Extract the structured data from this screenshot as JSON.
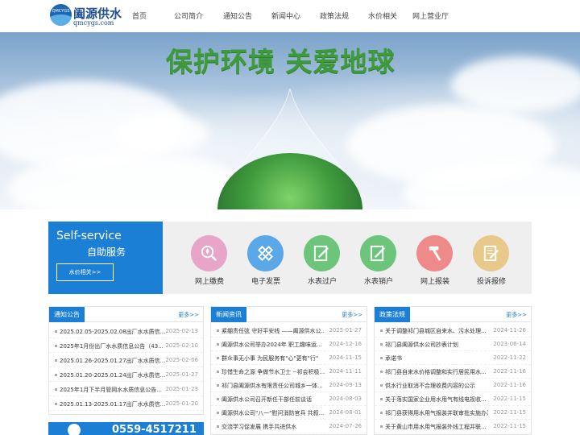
{
  "header": {
    "logo_tag": "QMCYGS",
    "logo_cn": "阖源供水",
    "logo_en": "qmcygs.com",
    "nav": [
      "首页",
      "公司简介",
      "通知公告",
      "新闻中心",
      "政策法规",
      "水价相关",
      "网上营业厅"
    ]
  },
  "banner": {
    "slogan": "保护环境 关爱地球"
  },
  "self_service": {
    "title_en": "Self-service",
    "title_cn": "自助服务",
    "button": "水价相关>>",
    "items": [
      {
        "label": "网上缴费",
        "color": "#e7a5c9",
        "icon": "search-drop-icon"
      },
      {
        "label": "电子发票",
        "color": "#5ba8e8",
        "icon": "ruler-pencil-icon"
      },
      {
        "label": "水表过户",
        "color": "#6cc57a",
        "icon": "document-edit-icon"
      },
      {
        "label": "水表销户",
        "color": "#6cc57a",
        "icon": "document-edit-icon"
      },
      {
        "label": "网上报装",
        "color": "#ee8a8a",
        "icon": "hammer-icon"
      },
      {
        "label": "投诉报修",
        "color": "#e8c989",
        "icon": "note-edit-icon"
      }
    ]
  },
  "notice": {
    "title": "通知公告",
    "more": "更多>>",
    "rows": [
      {
        "text": "2025.02.05-2025.02.08出厂水水质信...",
        "date": "2025-02-13"
      },
      {
        "text": "2025年1月份出厂水水质信息公告（43...",
        "date": "2025-02-10"
      },
      {
        "text": "2025.01.26-2025.01.27出厂水水质信...",
        "date": "2025-02-06"
      },
      {
        "text": "2025.01.20-2025.01.24出厂水水质信...",
        "date": "2025-01-27"
      },
      {
        "text": "2025年1月下半月管网水水质信息公告...",
        "date": "2025-01-23"
      },
      {
        "text": "2025.01.13-2025.01.17出厂水水质信...",
        "date": "2025-01-20"
      }
    ]
  },
  "news": {
    "title": "新闻资讯",
    "more": "更多>>",
    "rows": [
      {
        "text": "紧绷责任弦 守好平安线 ——阖源供水公...",
        "date": "2025-01-27"
      },
      {
        "text": "阖源供水公司举办2024年 职工趣味运...",
        "date": "2024-12-16"
      },
      {
        "text": "群众事无小事 为民服务有\"心\"更有\"行\"",
        "date": "2024-11-15"
      },
      {
        "text": "珍惜生命之源 争做节水卫士 --祁会积极...",
        "date": "2024-11-11"
      },
      {
        "text": "祁门县阖源供水有限责任公司城乡一体...",
        "date": "2024-09-13"
      },
      {
        "text": "阖源供水公司召开新任干部任前谈话",
        "date": "2024-08-03"
      },
      {
        "text": "阖源供水公司\"八一\"慰问消防官兵 共叙...",
        "date": "2024-08-01"
      },
      {
        "text": "交流学习促发展 携手共进供水",
        "date": "2024-07-26"
      }
    ]
  },
  "policy": {
    "title": "政策法规",
    "more": "更多>>",
    "rows": [
      {
        "text": "关于调整祁门县城区自来水、污水处理...",
        "date": "2024-11-26"
      },
      {
        "text": "祁门县阖源供水公司抄表计划",
        "date": "2023-06-14"
      },
      {
        "text": "承诺书",
        "date": "2022-11-22"
      },
      {
        "text": "祁门县自来水价格调整和实行居民用水...",
        "date": "2022-11-16"
      },
      {
        "text": "供水行业取消不合理收费内容的公示",
        "date": "2022-11-16"
      },
      {
        "text": "关于落实国家企业用水用气有线电视收...",
        "date": "2022-11-15"
      },
      {
        "text": "祁门县获得用水用气报装并联审批实施办法",
        "date": "2022-11-15"
      },
      {
        "text": "关于黄山市用水用气报装外线工程并联...",
        "date": "2022-11-15"
      }
    ]
  },
  "phone": {
    "number": "0559-4517211"
  }
}
